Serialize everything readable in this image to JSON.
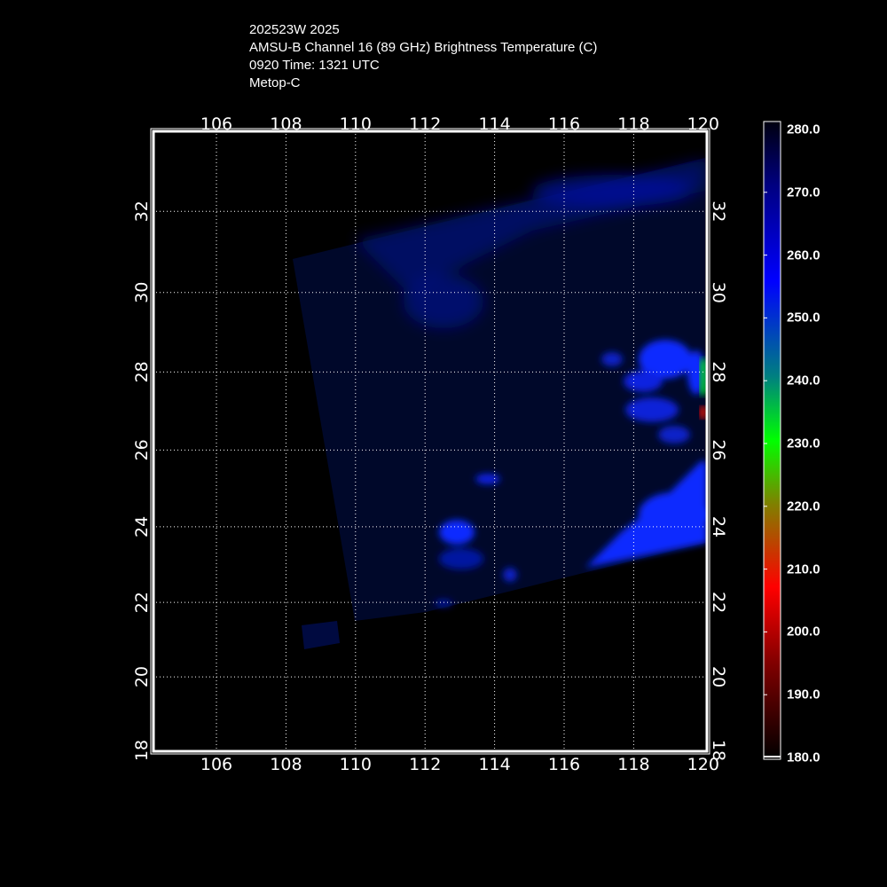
{
  "header": {
    "storm_id": "202523W 2025",
    "product": "AMSU-B Channel 16 (89 GHz) Brightness Temperature (C)",
    "time": "0920 Time: 1321 UTC",
    "satellite": "Metop-C"
  },
  "map": {
    "lon_ticks": [
      106,
      108,
      110,
      112,
      114,
      116,
      118,
      120
    ],
    "lat_ticks": [
      18,
      20,
      22,
      24,
      26,
      28,
      30,
      32
    ],
    "lon_range": [
      104.1,
      120.1
    ],
    "lat_range": [
      17.9,
      33.9
    ],
    "swath_color": "#00082a",
    "blob_colors": {
      "deep": "#0010c0",
      "bright": "#0a2cff",
      "green": "#00e020",
      "red": "#ff1000"
    }
  },
  "colorbar": {
    "min": 180,
    "max": 280,
    "labels": [
      "280.0",
      "270.0",
      "260.0",
      "250.0",
      "240.0",
      "230.0",
      "220.0",
      "210.0",
      "200.0",
      "190.0",
      "180.0"
    ],
    "stops": [
      {
        "v": 280,
        "c": "#00000f"
      },
      {
        "v": 270,
        "c": "#000080"
      },
      {
        "v": 255,
        "c": "#0000ff"
      },
      {
        "v": 240,
        "c": "#008080"
      },
      {
        "v": 230,
        "c": "#00ff00"
      },
      {
        "v": 220,
        "c": "#808000"
      },
      {
        "v": 207,
        "c": "#ff0000"
      },
      {
        "v": 195,
        "c": "#800000"
      },
      {
        "v": 180,
        "c": "#000000"
      }
    ]
  }
}
